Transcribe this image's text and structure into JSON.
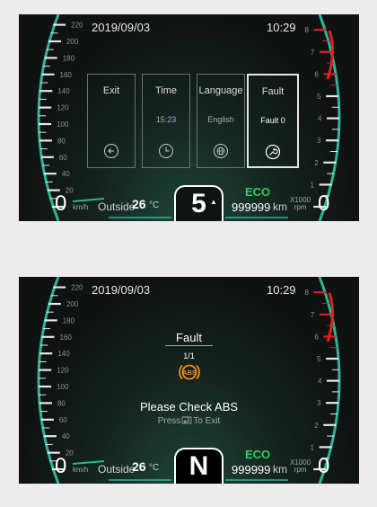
{
  "colors": {
    "accent_green": "#2bd15d",
    "redline": "#e02020",
    "arc_teal": "#2fb39a",
    "abs_orange": "#f08a12"
  },
  "speed_ticks": [
    "20",
    "40",
    "60",
    "80",
    "100",
    "120",
    "140",
    "160",
    "180",
    "200",
    "220"
  ],
  "rpm_ticks": [
    "1",
    "2",
    "3",
    "4",
    "5",
    "6",
    "7",
    "8"
  ],
  "screen1": {
    "date": "2019/09/03",
    "time": "10:29",
    "speed": "0",
    "speed_unit": "km/h",
    "outside_label": "Outside",
    "outside_temp": "26",
    "temp_unit": "°C",
    "eco": "ECO",
    "odometer": "999999",
    "odo_unit": "km",
    "rpm_multiplier_top": "X1000",
    "rpm_multiplier_bottom": "rpm",
    "rpm": "0",
    "gear": "5",
    "gear_arrow": "▲",
    "menu": [
      {
        "title": "Exit",
        "sub": "",
        "icon": "back-arrow-icon"
      },
      {
        "title": "Time",
        "sub": "15:23",
        "icon": "clock-icon"
      },
      {
        "title": "Language",
        "sub": "English",
        "icon": "globe-icon"
      },
      {
        "title": "Fault",
        "sub": "Fault 0",
        "icon": "wrench-icon"
      }
    ]
  },
  "screen2": {
    "date": "2019/09/03",
    "time": "10:29",
    "speed": "0",
    "speed_unit": "km/h",
    "outside_label": "Outside",
    "outside_temp": "26",
    "temp_unit": "°C",
    "eco": "ECO",
    "odometer": "999999",
    "odo_unit": "km",
    "rpm_multiplier_top": "X1000",
    "rpm_multiplier_bottom": "rpm",
    "rpm": "0",
    "gear": "N",
    "fault_title": "Fault",
    "fault_count": "1/1",
    "abs_label": "ABS",
    "fault_message": "Please Check ABS",
    "exit_prefix": "Press",
    "exit_suffix": "To Exit"
  }
}
